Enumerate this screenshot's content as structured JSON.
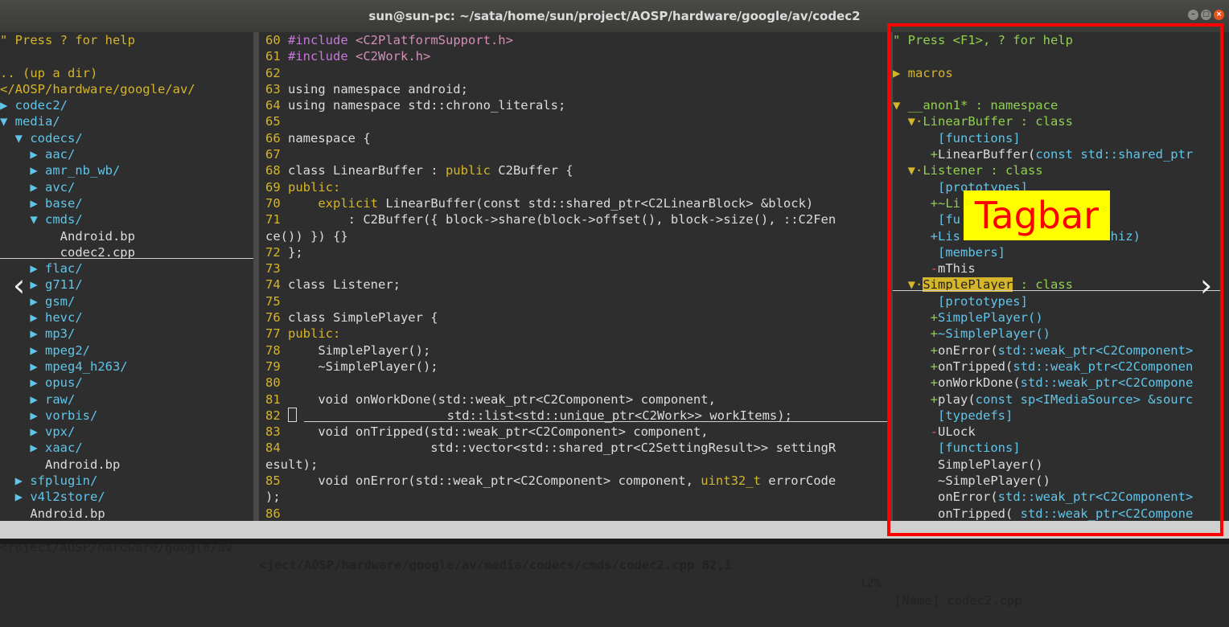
{
  "window": {
    "title": "sun@sun-pc: ~/sata/home/sun/project/AOSP/hardware/google/av/codec2",
    "buttons": [
      "minimize",
      "maximize",
      "close"
    ]
  },
  "left_pane": {
    "lines": [
      {
        "t": "\" Press ? for help",
        "c": "comment"
      },
      {
        "t": "",
        "c": "file"
      },
      {
        "t": ".. (up a dir)",
        "c": "path"
      },
      {
        "t": "</AOSP/hardware/google/av/",
        "c": "path"
      },
      {
        "t": "▶ codec2/",
        "c": "dir"
      },
      {
        "t": "▼ media/",
        "c": "dir"
      },
      {
        "t": "  ▼ codecs/",
        "c": "dir"
      },
      {
        "t": "    ▶ aac/",
        "c": "dir"
      },
      {
        "t": "    ▶ amr_nb_wb/",
        "c": "dir"
      },
      {
        "t": "    ▶ avc/",
        "c": "dir"
      },
      {
        "t": "    ▶ base/",
        "c": "dir"
      },
      {
        "t": "    ▼ cmds/",
        "c": "dir"
      },
      {
        "t": "        Android.bp",
        "c": "file"
      },
      {
        "t": "        codec2.cpp",
        "c": "file"
      },
      {
        "t": "    ▶ flac/",
        "c": "dir"
      },
      {
        "t": "    ▶ g711/",
        "c": "dir"
      },
      {
        "t": "    ▶ gsm/",
        "c": "dir"
      },
      {
        "t": "    ▶ hevc/",
        "c": "dir"
      },
      {
        "t": "    ▶ mp3/",
        "c": "dir"
      },
      {
        "t": "    ▶ mpeg2/",
        "c": "dir"
      },
      {
        "t": "    ▶ mpeg4_h263/",
        "c": "dir"
      },
      {
        "t": "    ▶ opus/",
        "c": "dir"
      },
      {
        "t": "    ▶ raw/",
        "c": "dir"
      },
      {
        "t": "    ▶ vorbis/",
        "c": "dir"
      },
      {
        "t": "    ▶ vpx/",
        "c": "dir"
      },
      {
        "t": "    ▶ xaac/",
        "c": "dir"
      },
      {
        "t": "      Android.bp",
        "c": "file"
      },
      {
        "t": "  ▶ sfplugin/",
        "c": "dir"
      },
      {
        "t": "  ▶ v4l2store/",
        "c": "dir"
      },
      {
        "t": "    Android.bp",
        "c": "file"
      }
    ]
  },
  "code_pane": {
    "lines": [
      {
        "n": "60",
        "segs": [
          {
            "t": "#include ",
            "c": "pp"
          },
          {
            "t": "<C2PlatformSupport.h>",
            "c": "inc"
          }
        ]
      },
      {
        "n": "61",
        "segs": [
          {
            "t": "#include ",
            "c": "pp"
          },
          {
            "t": "<C2Work.h>",
            "c": "inc"
          }
        ]
      },
      {
        "n": "62",
        "segs": []
      },
      {
        "n": "63",
        "segs": [
          {
            "t": "using namespace android;",
            "c": "txt"
          }
        ]
      },
      {
        "n": "64",
        "segs": [
          {
            "t": "using namespace std::chrono_literals;",
            "c": "txt"
          }
        ]
      },
      {
        "n": "65",
        "segs": []
      },
      {
        "n": "66",
        "segs": [
          {
            "t": "namespace {",
            "c": "txt"
          }
        ]
      },
      {
        "n": "67",
        "segs": []
      },
      {
        "n": "68",
        "segs": [
          {
            "t": "class LinearBuffer : ",
            "c": "txt"
          },
          {
            "t": "public",
            "c": "kw"
          },
          {
            "t": " C2Buffer {",
            "c": "txt"
          }
        ]
      },
      {
        "n": "69",
        "segs": [
          {
            "t": "public:",
            "c": "kw"
          }
        ]
      },
      {
        "n": "70",
        "segs": [
          {
            "t": "    explicit ",
            "c": "kw"
          },
          {
            "t": "LinearBuffer(const std::shared_ptr<C2LinearBlock> &block)",
            "c": "txt"
          }
        ]
      },
      {
        "n": "71",
        "segs": [
          {
            "t": "        : C2Buffer({ block->share(block->offset(), block->size(), ::C2Fen",
            "c": "txt"
          }
        ]
      },
      {
        "n": "",
        "segs": [
          {
            "t": "ce()) }) {}",
            "c": "txt"
          }
        ]
      },
      {
        "n": "72",
        "segs": [
          {
            "t": "};",
            "c": "txt"
          }
        ]
      },
      {
        "n": "73",
        "segs": []
      },
      {
        "n": "74",
        "segs": [
          {
            "t": "class Listener;",
            "c": "txt"
          }
        ]
      },
      {
        "n": "75",
        "segs": []
      },
      {
        "n": "76",
        "segs": [
          {
            "t": "class SimplePlayer {",
            "c": "txt"
          }
        ]
      },
      {
        "n": "77",
        "segs": [
          {
            "t": "public:",
            "c": "kw"
          }
        ]
      },
      {
        "n": "78",
        "segs": [
          {
            "t": "    SimplePlayer();",
            "c": "txt"
          }
        ]
      },
      {
        "n": "79",
        "segs": [
          {
            "t": "    ~SimplePlayer();",
            "c": "txt"
          }
        ]
      },
      {
        "n": "80",
        "segs": []
      },
      {
        "n": "81",
        "segs": [
          {
            "t": "    void onWorkDone(std::weak_ptr<C2Component> component,",
            "c": "txt"
          }
        ]
      },
      {
        "n": "82",
        "segs": [
          {
            "t": "                    std::list<std::unique_ptr<C2Work>> workItems);",
            "c": "txt"
          }
        ],
        "cursor": true
      },
      {
        "n": "83",
        "segs": [
          {
            "t": "    void onTripped(std::weak_ptr<C2Component> component,",
            "c": "txt"
          }
        ]
      },
      {
        "n": "84",
        "segs": [
          {
            "t": "                   std::vector<std::shared_ptr<C2SettingResult>> settingR",
            "c": "txt"
          }
        ]
      },
      {
        "n": "",
        "segs": [
          {
            "t": "esult);",
            "c": "txt"
          }
        ]
      },
      {
        "n": "85",
        "segs": [
          {
            "t": "    void onError(std::weak_ptr<C2Component> component, ",
            "c": "txt"
          },
          {
            "t": "uint32_t",
            "c": "kw"
          },
          {
            "t": " errorCode",
            "c": "txt"
          }
        ]
      },
      {
        "n": "",
        "segs": [
          {
            "t": ");",
            "c": "txt"
          }
        ]
      },
      {
        "n": "86",
        "segs": []
      }
    ]
  },
  "tagbar_pane": {
    "lines": [
      {
        "segs": [
          {
            "t": "\" Press <F1>, ? for help",
            "c": "green"
          }
        ]
      },
      {
        "segs": []
      },
      {
        "segs": [
          {
            "t": "▶ macros",
            "c": "kw"
          }
        ]
      },
      {
        "segs": []
      },
      {
        "segs": [
          {
            "t": "▼ ",
            "c": "kw"
          },
          {
            "t": "__anon1* : namespace",
            "c": "green"
          }
        ]
      },
      {
        "segs": [
          {
            "t": "  ▼·",
            "c": "kw"
          },
          {
            "t": "LinearBuffer : class",
            "c": "green"
          }
        ]
      },
      {
        "segs": [
          {
            "t": "      [functions]",
            "c": "cyan"
          }
        ]
      },
      {
        "segs": [
          {
            "t": "     +",
            "c": "green"
          },
          {
            "t": "LinearBuffer(",
            "c": "txt"
          },
          {
            "t": "const std::shared_ptr",
            "c": "cyan"
          }
        ]
      },
      {
        "segs": [
          {
            "t": "  ▼·",
            "c": "kw"
          },
          {
            "t": "Listener : class",
            "c": "green"
          }
        ]
      },
      {
        "segs": [
          {
            "t": "      [prototypes]",
            "c": "cyan"
          }
        ]
      },
      {
        "segs": [
          {
            "t": "     +~Li",
            "c": "green"
          }
        ]
      },
      {
        "segs": [
          {
            "t": "      [fu",
            "c": "cyan"
          }
        ]
      },
      {
        "segs": [
          {
            "t": "     +Lis                 * thiz)",
            "c": "cyan"
          }
        ]
      },
      {
        "segs": [
          {
            "t": "      [members]",
            "c": "cyan"
          }
        ]
      },
      {
        "segs": [
          {
            "t": "     -",
            "c": "red"
          },
          {
            "t": "mThis",
            "c": "txt"
          }
        ]
      },
      {
        "segs": [
          {
            "t": "  ▼·",
            "c": "kw"
          },
          {
            "t": "SimplePlayer",
            "c": "hi"
          },
          {
            "t": " : class",
            "c": "green"
          }
        ]
      },
      {
        "segs": [
          {
            "t": "      [prototypes]",
            "c": "cyan"
          }
        ]
      },
      {
        "segs": [
          {
            "t": "     +",
            "c": "green"
          },
          {
            "t": "SimplePlayer()",
            "c": "cyan"
          }
        ]
      },
      {
        "segs": [
          {
            "t": "     +",
            "c": "green"
          },
          {
            "t": "~SimplePlayer()",
            "c": "cyan"
          }
        ]
      },
      {
        "segs": [
          {
            "t": "     +",
            "c": "green"
          },
          {
            "t": "onError(",
            "c": "txt"
          },
          {
            "t": "std::weak_ptr<C2Component>",
            "c": "cyan"
          }
        ]
      },
      {
        "segs": [
          {
            "t": "     +",
            "c": "green"
          },
          {
            "t": "onTripped(",
            "c": "txt"
          },
          {
            "t": "std::weak_ptr<C2Componen",
            "c": "cyan"
          }
        ]
      },
      {
        "segs": [
          {
            "t": "     +",
            "c": "green"
          },
          {
            "t": "onWorkDone(",
            "c": "txt"
          },
          {
            "t": "std::weak_ptr<C2Compone",
            "c": "cyan"
          }
        ]
      },
      {
        "segs": [
          {
            "t": "     +",
            "c": "green"
          },
          {
            "t": "play(",
            "c": "txt"
          },
          {
            "t": "const sp<IMediaSource> &sourc",
            "c": "cyan"
          }
        ]
      },
      {
        "segs": [
          {
            "t": "      [typedefs]",
            "c": "cyan"
          }
        ]
      },
      {
        "segs": [
          {
            "t": "     -",
            "c": "red"
          },
          {
            "t": "ULock",
            "c": "txt"
          }
        ]
      },
      {
        "segs": [
          {
            "t": "      [functions]",
            "c": "cyan"
          }
        ]
      },
      {
        "segs": [
          {
            "t": "      SimplePlayer()",
            "c": "txt"
          }
        ]
      },
      {
        "segs": [
          {
            "t": "      ~SimplePlayer()",
            "c": "txt"
          }
        ]
      },
      {
        "segs": [
          {
            "t": "      onError(",
            "c": "txt"
          },
          {
            "t": "std::weak_ptr<C2Component>",
            "c": "cyan"
          }
        ]
      },
      {
        "segs": [
          {
            "t": "      onTripped( ",
            "c": "txt"
          },
          {
            "t": "std::weak_ptr<C2Compone",
            "c": "cyan"
          }
        ]
      }
    ]
  },
  "statusbar": {
    "left": "<roject/AOSP/hardware/google/av",
    "middle": "<ject/AOSP/hardware/google/av/media/codecs/cmds/codec2.cpp 82,1",
    "percent": "12%",
    "right": "[Name] codec2.cpp"
  },
  "annotation": {
    "label": "Tagbar",
    "label_bg": "#ffff00",
    "label_color": "#ff0000",
    "frame_color": "#ff0000"
  },
  "nav": {
    "prev": "‹",
    "next": "›"
  }
}
